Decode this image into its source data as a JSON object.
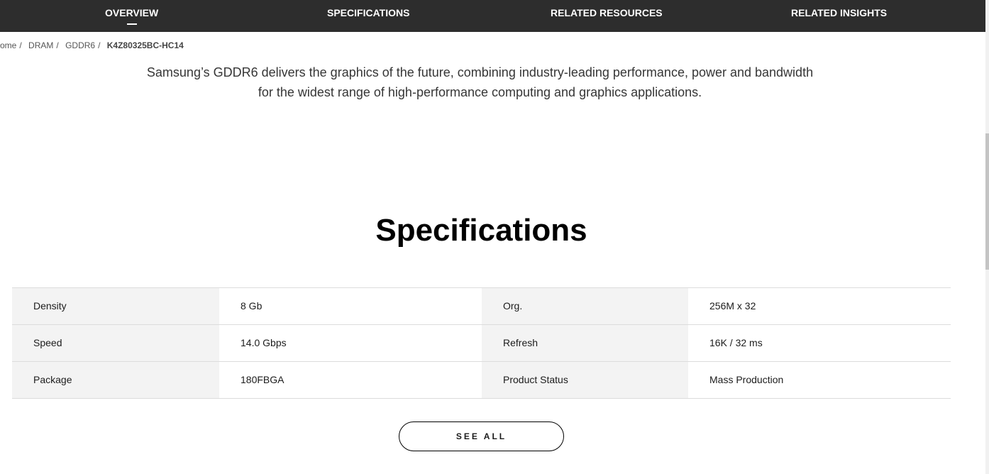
{
  "topnav": {
    "tabs": [
      {
        "label": "OVERVIEW",
        "active": true
      },
      {
        "label": "SPECIFICATIONS",
        "active": false
      },
      {
        "label": "RELATED RESOURCES",
        "active": false
      },
      {
        "label": "RELATED INSIGHTS",
        "active": false
      }
    ]
  },
  "breadcrumb": {
    "items": [
      "ome",
      "DRAM",
      "GDDR6"
    ],
    "separator": "/",
    "current": "K4Z80325BC-HC14"
  },
  "intro": {
    "line1": "Samsung’s GDDR6 delivers the graphics of the future, combining industry-leading performance, power and bandwidth",
    "line2": "for the widest range of high-performance computing and graphics applications."
  },
  "specifications": {
    "title": "Specifications",
    "rows": [
      {
        "label1": "Density",
        "value1": "8 Gb",
        "label2": "Org.",
        "value2": "256M x 32"
      },
      {
        "label1": "Speed",
        "value1": "14.0 Gbps",
        "label2": "Refresh",
        "value2": "16K / 32 ms"
      },
      {
        "label1": "Package",
        "value1": "180FBGA",
        "label2": "Product Status",
        "value2": "Mass Production"
      }
    ],
    "see_all_label": "SEE ALL"
  },
  "colors": {
    "nav_background": "#2d2d2d",
    "label_cell_background": "#f3f3f3"
  }
}
